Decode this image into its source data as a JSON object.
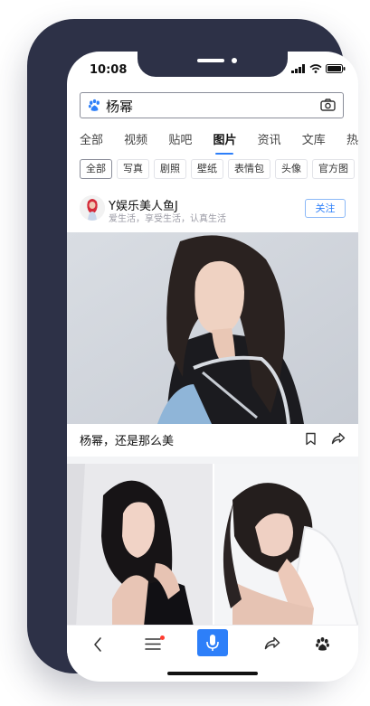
{
  "status_bar": {
    "time": "10:08"
  },
  "search": {
    "query": "杨幂"
  },
  "tabs": [
    {
      "label": "全部"
    },
    {
      "label": "视频"
    },
    {
      "label": "贴吧"
    },
    {
      "label": "图片"
    },
    {
      "label": "资讯"
    },
    {
      "label": "文库"
    },
    {
      "label": "热"
    }
  ],
  "active_tab": "图片",
  "chips": [
    {
      "label": "全部"
    },
    {
      "label": "写真"
    },
    {
      "label": "剧照"
    },
    {
      "label": "壁纸"
    },
    {
      "label": "表情包"
    },
    {
      "label": "头像"
    },
    {
      "label": "官方图"
    }
  ],
  "post": {
    "author": "Y娱乐美人鱼J",
    "tagline": "爱生活，享受生活，认真生活",
    "follow_label": "关注",
    "caption": "杨幂，还是那么美"
  },
  "colors": {
    "accent": "#2d7ff9",
    "phone_frame": "#2d3147"
  }
}
